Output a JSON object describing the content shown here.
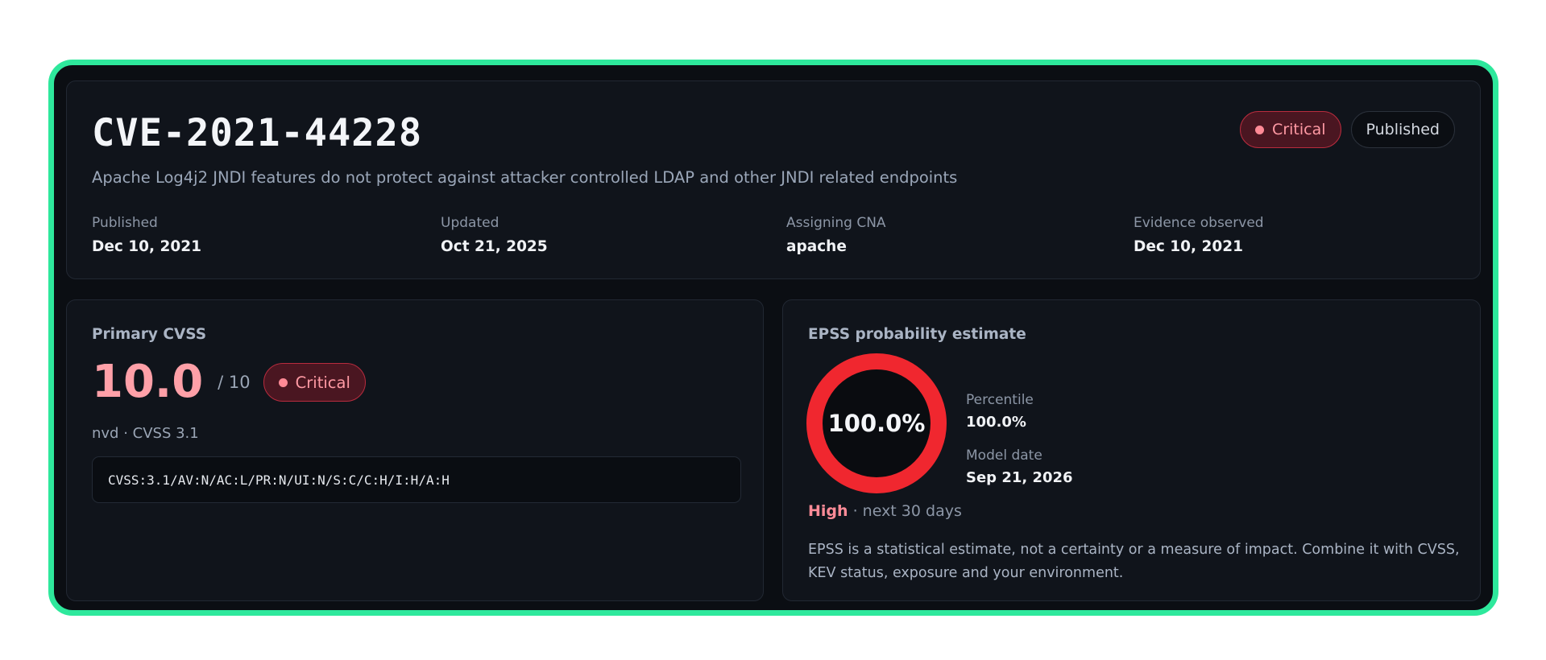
{
  "cve": {
    "id": "CVE-2021-44228",
    "summary": "Apache Log4j2 JNDI features do not protect against attacker controlled LDAP and other JNDI related endpoints",
    "severity_badge": "Critical",
    "status_badge": "Published"
  },
  "meta": [
    {
      "label": "Published",
      "value": "Dec 10, 2021"
    },
    {
      "label": "Updated",
      "value": "Oct 21, 2025"
    },
    {
      "label": "Assigning CNA",
      "value": "apache"
    },
    {
      "label": "Evidence observed",
      "value": "Dec 10, 2021"
    }
  ],
  "cvss": {
    "title": "Primary CVSS",
    "score": "10.0",
    "max": "/ 10",
    "severity": "Critical",
    "source": "nvd · CVSS 3.1",
    "vector": "CVSS:3.1/AV:N/AC:L/PR:N/UI:N/S:C/C:H/I:H/A:H"
  },
  "epss": {
    "title": "EPSS probability estimate",
    "probability_label": "100.0%",
    "probability_fraction": 1.0,
    "percentile_label": "Percentile",
    "percentile_value": "100.0%",
    "model_date_label": "Model date",
    "model_date_value": "Sep 21, 2026",
    "risk_level": "High",
    "risk_window": " · next 30 days",
    "disclaimer": "EPSS is a statistical estimate, not a certainty or a measure of impact. Combine it with CVSS, KEV status, exposure and your environment."
  },
  "colors": {
    "accent_frame": "#2ee89c",
    "critical": "#ff9aa4",
    "gauge_fill": "#f0272f",
    "gauge_track": "#3a1a1e"
  }
}
